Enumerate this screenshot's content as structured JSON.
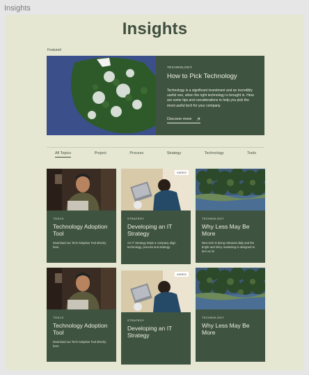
{
  "frame": {
    "label": "Insights"
  },
  "page": {
    "title": "Insights",
    "featured_label": "Featured"
  },
  "hero": {
    "category": "TECHNOLOGY",
    "title": "How to Pick Technology",
    "description": "Technology is a significant investment and an incredibly useful one, when the right technology is brought in. Here are some tips and considerations to help you pick the most useful tech for your company.",
    "link_label": "Discover more",
    "link_icon": "arrow-up-right-icon"
  },
  "tabs": [
    "All Topics",
    "Project",
    "Process",
    "Strategy",
    "Technology",
    "Tools"
  ],
  "active_tab": "All Topics",
  "cards": [
    {
      "category": "TOOLS",
      "title": "Technology Adoption Tool",
      "description": "Download our Tech Adoption Tool directly here.",
      "badge": "",
      "image": "person-laptop"
    },
    {
      "category": "STRATEGY",
      "title": "Developing an IT Strategy",
      "description": "An IT Strategy helps a company align technology, process and strategy.",
      "badge": "VIDEO",
      "image": "overhead-laptop"
    },
    {
      "category": "TECHNOLOGY",
      "title": "Why Less May Be More",
      "description": "New tech is being released daily and the bright and shiny marketing is designed to lure us in!",
      "badge": "",
      "image": "forest-aerial"
    },
    {
      "category": "TOOLS",
      "title": "Technology Adoption Tool",
      "description": "Download our Tech Adoption Tool directly here.",
      "badge": "",
      "image": "person-laptop"
    },
    {
      "category": "STRATEGY",
      "title": "Developing an IT Strategy",
      "description": "",
      "badge": "VIDEO",
      "image": "overhead-laptop"
    },
    {
      "category": "TECHNOLOGY",
      "title": "Why Less May Be More",
      "description": "",
      "badge": "",
      "image": "forest-aerial"
    }
  ],
  "colors": {
    "page_background": "#e6e7d3",
    "card_green": "#3e5340",
    "heading": "#3f4f3d"
  }
}
